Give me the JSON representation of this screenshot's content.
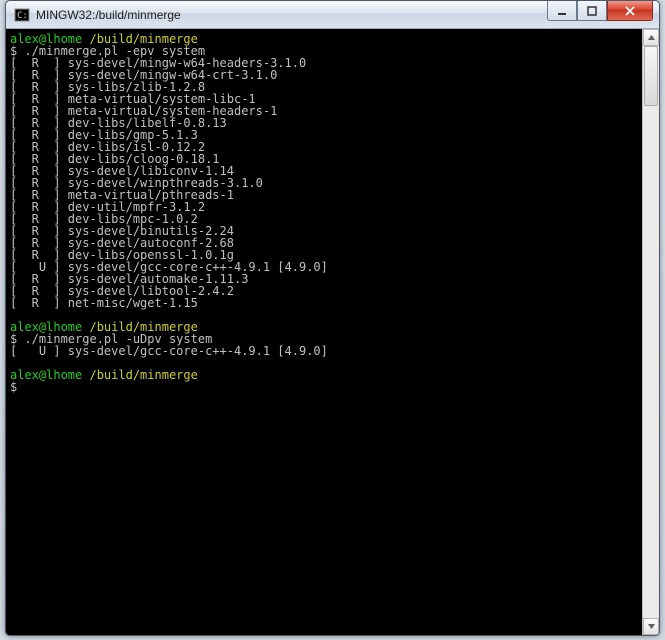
{
  "window": {
    "title": "MINGW32:/build/minmerge"
  },
  "session1": {
    "prompt_user": "alex@lhome",
    "prompt_path": "/build/minmerge",
    "command": "./minmerge.pl -epv system",
    "lines": [
      {
        "flags": "[  R  ]",
        "pkg": "sys-devel/mingw-w64-headers-3.1.0"
      },
      {
        "flags": "[  R  ]",
        "pkg": "sys-devel/mingw-w64-crt-3.1.0"
      },
      {
        "flags": "[  R  ]",
        "pkg": "sys-libs/zlib-1.2.8"
      },
      {
        "flags": "[  R  ]",
        "pkg": "meta-virtual/system-libc-1"
      },
      {
        "flags": "[  R  ]",
        "pkg": "meta-virtual/system-headers-1"
      },
      {
        "flags": "[  R  ]",
        "pkg": "dev-libs/libelf-0.8.13"
      },
      {
        "flags": "[  R  ]",
        "pkg": "dev-libs/gmp-5.1.3"
      },
      {
        "flags": "[  R  ]",
        "pkg": "dev-libs/isl-0.12.2"
      },
      {
        "flags": "[  R  ]",
        "pkg": "dev-libs/cloog-0.18.1"
      },
      {
        "flags": "[  R  ]",
        "pkg": "sys-devel/libiconv-1.14"
      },
      {
        "flags": "[  R  ]",
        "pkg": "sys-devel/winpthreads-3.1.0"
      },
      {
        "flags": "[  R  ]",
        "pkg": "meta-virtual/pthreads-1"
      },
      {
        "flags": "[  R  ]",
        "pkg": "dev-util/mpfr-3.1.2"
      },
      {
        "flags": "[  R  ]",
        "pkg": "dev-libs/mpc-1.0.2"
      },
      {
        "flags": "[  R  ]",
        "pkg": "sys-devel/binutils-2.24"
      },
      {
        "flags": "[  R  ]",
        "pkg": "sys-devel/autoconf-2.68"
      },
      {
        "flags": "[  R  ]",
        "pkg": "dev-libs/openssl-1.0.1g"
      },
      {
        "flags": "[   U ]",
        "pkg": "sys-devel/gcc-core-c++-4.9.1 [4.9.0]"
      },
      {
        "flags": "[  R  ]",
        "pkg": "sys-devel/automake-1.11.3"
      },
      {
        "flags": "[  R  ]",
        "pkg": "sys-devel/libtool-2.4.2"
      },
      {
        "flags": "[  R  ]",
        "pkg": "net-misc/wget-1.15"
      }
    ]
  },
  "session2": {
    "prompt_user": "alex@lhome",
    "prompt_path": "/build/minmerge",
    "command": "./minmerge.pl -uDpv system",
    "lines": [
      {
        "flags": "[   U ]",
        "pkg": "sys-devel/gcc-core-c++-4.9.1 [4.9.0]"
      }
    ]
  },
  "session3": {
    "prompt_user": "alex@lhome",
    "prompt_path": "/build/minmerge",
    "cursor": "$"
  }
}
